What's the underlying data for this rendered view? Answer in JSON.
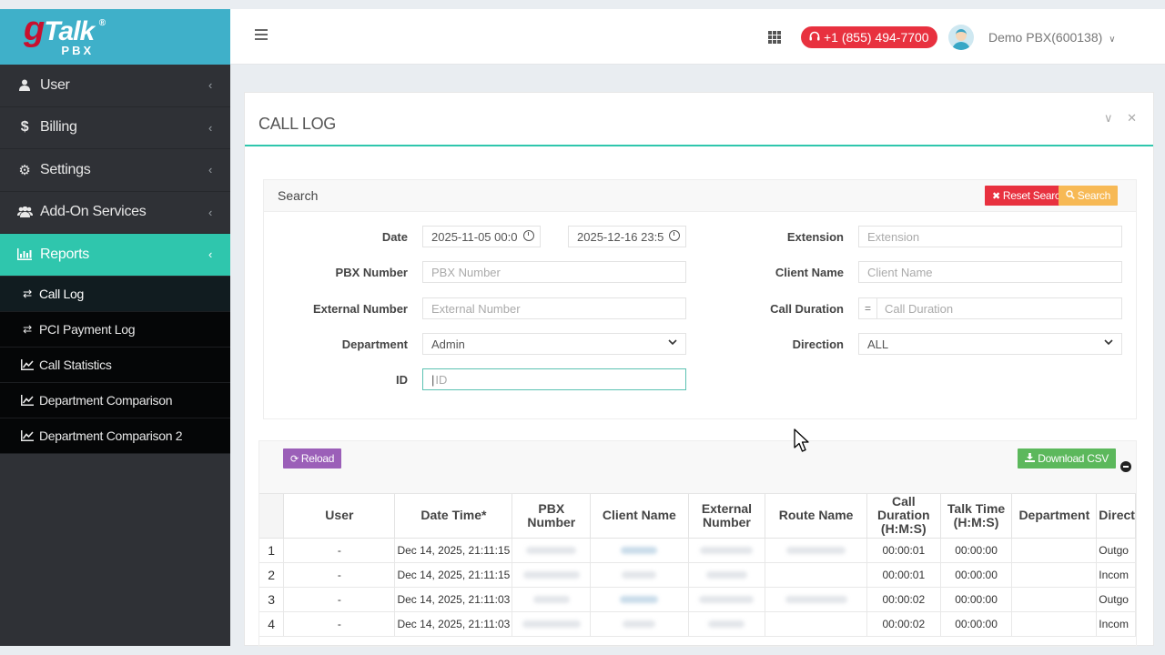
{
  "brand": {
    "logo_main": "Talk",
    "logo_g": "g",
    "logo_sub": "PBX",
    "logo_reg": "®"
  },
  "sidebar": {
    "items": [
      {
        "label": "User",
        "icon": "user-icon"
      },
      {
        "label": "Billing",
        "icon": "dollar-icon"
      },
      {
        "label": "Settings",
        "icon": "gear-icon"
      },
      {
        "label": "Add-On Services",
        "icon": "users-icon"
      },
      {
        "label": "Reports",
        "icon": "bar-chart-icon",
        "active": true
      }
    ],
    "subitems": [
      {
        "label": "Call Log",
        "icon": "exchange-icon",
        "active": true
      },
      {
        "label": "PCI Payment Log",
        "icon": "exchange-icon"
      },
      {
        "label": "Call Statistics",
        "icon": "line-chart-icon"
      },
      {
        "label": "Department Comparison",
        "icon": "line-chart-icon"
      },
      {
        "label": "Department Comparison 2",
        "icon": "line-chart-icon"
      }
    ]
  },
  "header": {
    "phone": "+1 (855) 494-7700",
    "user": "Demo PBX(600138)"
  },
  "panel": {
    "title": "CALL LOG"
  },
  "search": {
    "title": "Search",
    "reset_label": "Reset Search",
    "search_label": "Search",
    "fields": {
      "date_label": "Date",
      "date_from": "2025-11-05 00:0",
      "date_to": "2025-12-16 23:5",
      "pbx_label": "PBX Number",
      "pbx_placeholder": "PBX Number",
      "external_label": "External Number",
      "external_placeholder": "External Number",
      "department_label": "Department",
      "department_value": "Admin",
      "id_label": "ID",
      "id_placeholder": "ID",
      "extension_label": "Extension",
      "extension_placeholder": "Extension",
      "client_label": "Client Name",
      "client_placeholder": "Client Name",
      "duration_label": "Call Duration",
      "duration_op": "=",
      "duration_placeholder": "Call Duration",
      "direction_label": "Direction",
      "direction_value": "ALL"
    }
  },
  "table": {
    "reload_label": "Reload",
    "csv_label": "Download CSV",
    "columns": [
      "",
      "User",
      "Date Time*",
      "PBX Number",
      "Client Name",
      "External Number",
      "Route Name",
      "Call Duration (H:M:S)",
      "Talk Time (H:M:S)",
      "Department",
      "Direct"
    ],
    "rows": [
      {
        "n": "1",
        "user": "-",
        "datetime": "Dec 14, 2025, 21:11:15",
        "duration": "00:00:01",
        "talk": "00:00:00",
        "department": "",
        "direction": "Outgo"
      },
      {
        "n": "2",
        "user": "-",
        "datetime": "Dec 14, 2025, 21:11:15",
        "duration": "00:00:01",
        "talk": "00:00:00",
        "department": "",
        "direction": "Incom"
      },
      {
        "n": "3",
        "user": "-",
        "datetime": "Dec 14, 2025, 21:11:03",
        "duration": "00:00:02",
        "talk": "00:00:00",
        "department": "",
        "direction": "Outgo"
      },
      {
        "n": "4",
        "user": "-",
        "datetime": "Dec 14, 2025, 21:11:03",
        "duration": "00:00:02",
        "talk": "00:00:00",
        "department": "",
        "direction": "Incom"
      }
    ]
  },
  "colors": {
    "brand": "#3fb0c9",
    "accent": "#2fc6ad",
    "danger": "#e8313f",
    "warning": "#f7b955",
    "reload": "#9b5fb8",
    "success": "#5cb85c"
  }
}
